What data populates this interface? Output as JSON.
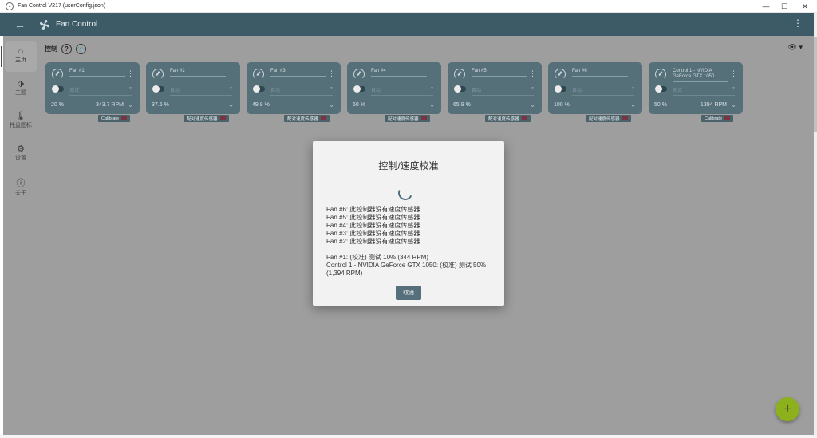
{
  "window": {
    "title": "Fan Control V217 (userConfig.json)",
    "minimize": "—",
    "maximize": "☐",
    "close": "✕"
  },
  "appbar": {
    "back": "←",
    "name": "Fan Control",
    "more": "⋮"
  },
  "nav": [
    {
      "label": "主页",
      "icon": "⌂"
    },
    {
      "label": "主题",
      "icon": "⬗"
    },
    {
      "label": "托盘图标",
      "icon": "🌡"
    },
    {
      "label": "设置",
      "icon": "⚙"
    },
    {
      "label": "关于",
      "icon": "ⓘ"
    }
  ],
  "section": {
    "title": "控制",
    "help": "?",
    "tool": "🔧",
    "eye": "👁 ▾"
  },
  "cards": [
    {
      "name": "Fan #1",
      "mode": "测试",
      "pct": "20 %",
      "rpm": "343.7 RPM",
      "badge": "Calibrate"
    },
    {
      "name": "Fan #2",
      "mode": "自动",
      "pct": "37.6 %",
      "rpm": "",
      "badge": "配对速度传感器"
    },
    {
      "name": "Fan #3",
      "mode": "自动",
      "pct": "49.8 %",
      "rpm": "",
      "badge": "配对速度传感器"
    },
    {
      "name": "Fan #4",
      "mode": "自动",
      "pct": "60 %",
      "rpm": "",
      "badge": "配对速度传感器"
    },
    {
      "name": "Fan #5",
      "mode": "自动",
      "pct": "65.9 %",
      "rpm": "",
      "badge": "配对速度传感器"
    },
    {
      "name": "Fan #6",
      "mode": "自动",
      "pct": "100 %",
      "rpm": "",
      "badge": "配对速度传感器"
    },
    {
      "name": "Control 1 - NVIDIA GeForce GTX 1050",
      "mode": "测试",
      "pct": "50 %",
      "rpm": "1394 RPM",
      "badge": "Calibrate"
    }
  ],
  "modal": {
    "title": "控制/速度校准",
    "lines1": [
      "Fan #6: 此控制器没有速度传感器",
      "Fan #5: 此控制器没有速度传感器",
      "Fan #4: 此控制器没有速度传感器",
      "Fan #3: 此控制器没有速度传感器",
      "Fan #2: 此控制器没有速度传感器"
    ],
    "lines2": [
      "Fan #1: (校准) 测试 10% (344 RPM)",
      "Control 1 - NVIDIA GeForce GTX 1050: (校准) 测试 50% (1,394 RPM)"
    ],
    "cancel": "取消"
  },
  "fab": "+",
  "colors": {
    "appbar": "#3d5a67",
    "card": "#56707a",
    "fab": "#8cb11c"
  }
}
